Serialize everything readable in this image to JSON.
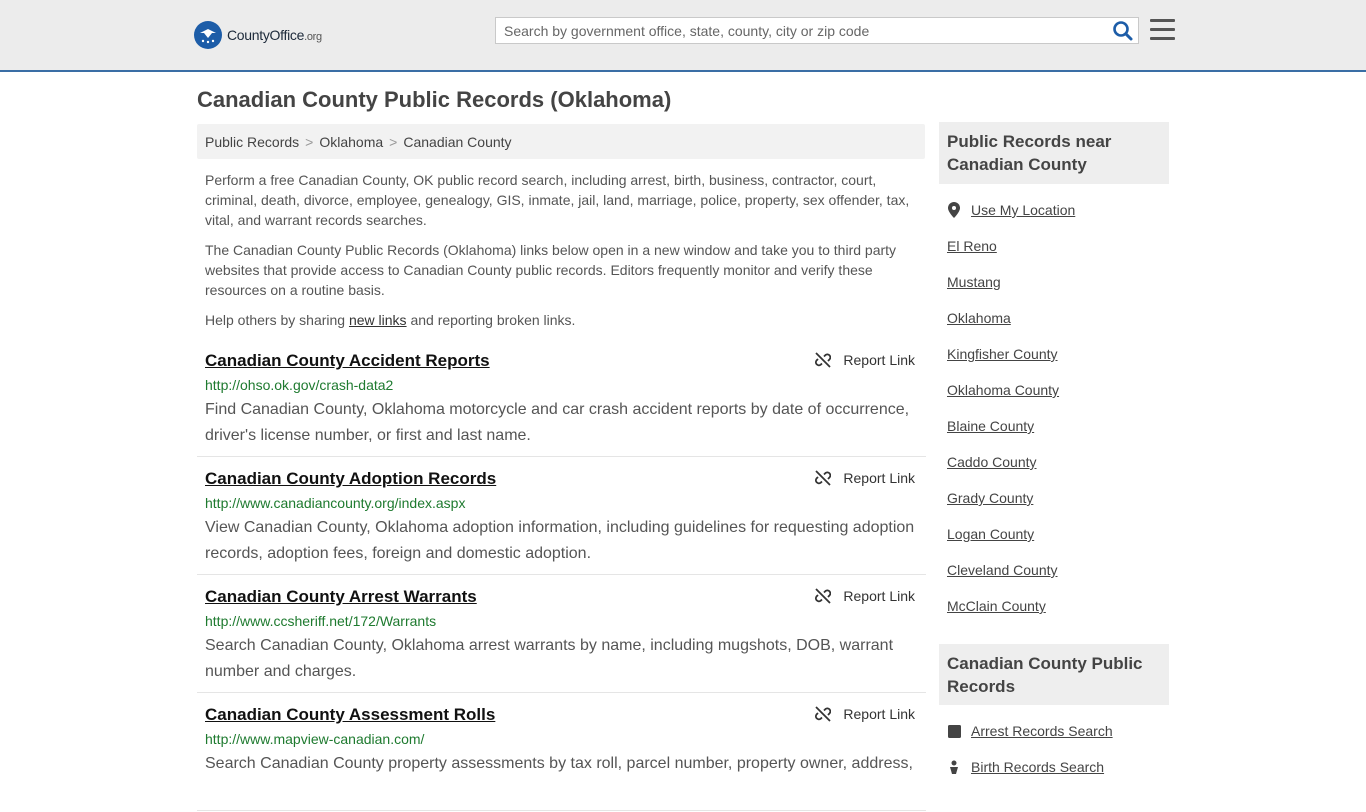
{
  "header": {
    "logo_text": "CountyOffice",
    "logo_tld": ".org",
    "search_placeholder": "Search by government office, state, county, city or zip code"
  },
  "page": {
    "title": "Canadian County Public Records (Oklahoma)"
  },
  "breadcrumb": [
    "Public Records",
    "Oklahoma",
    "Canadian County"
  ],
  "intro": {
    "p1": "Perform a free Canadian County, OK public record search, including arrest, birth, business, contractor, court, criminal, death, divorce, employee, genealogy, GIS, inmate, jail, land, marriage, police, property, sex offender, tax, vital, and warrant records searches.",
    "p2": "The Canadian County Public Records (Oklahoma) links below open in a new window and take you to third party websites that provide access to Canadian County public records. Editors frequently monitor and verify these resources on a routine basis.",
    "p3_pre": "Help others by sharing ",
    "p3_link": "new links",
    "p3_post": " and reporting broken links."
  },
  "records": [
    {
      "title": "Canadian County Accident Reports",
      "url": "http://ohso.ok.gov/crash-data2",
      "description": "Find Canadian County, Oklahoma motorcycle and car crash accident reports by date of occurrence, driver's license number, or first and last name.",
      "report_label": "Report Link"
    },
    {
      "title": "Canadian County Adoption Records",
      "url": "http://www.canadiancounty.org/index.aspx",
      "description": "View Canadian County, Oklahoma adoption information, including guidelines for requesting adoption records, adoption fees, foreign and domestic adoption.",
      "report_label": "Report Link"
    },
    {
      "title": "Canadian County Arrest Warrants",
      "url": "http://www.ccsheriff.net/172/Warrants",
      "description": "Search Canadian County, Oklahoma arrest warrants by name, including mugshots, DOB, warrant number and charges.",
      "report_label": "Report Link"
    },
    {
      "title": "Canadian County Assessment Rolls",
      "url": "http://www.mapview-canadian.com/",
      "description": "Search Canadian County property assessments by tax roll, parcel number, property owner, address,",
      "report_label": "Report Link"
    }
  ],
  "sidebar": {
    "nearby_heading": "Public Records near Canadian County",
    "use_location": "Use My Location",
    "nearby": [
      "El Reno",
      "Mustang",
      "Oklahoma",
      "Kingfisher County",
      "Oklahoma County",
      "Blaine County",
      "Caddo County",
      "Grady County",
      "Logan County",
      "Cleveland County",
      "McClain County"
    ],
    "county_heading": "Canadian County Public Records",
    "county_links": [
      "Arrest Records Search",
      "Birth Records Search"
    ]
  },
  "colors": {
    "header_bg": "#ececec",
    "header_border": "#3a6ea5",
    "logo_blue": "#1d5da8",
    "url_green": "#1e7a2f",
    "search_icon": "#1d5da8"
  }
}
